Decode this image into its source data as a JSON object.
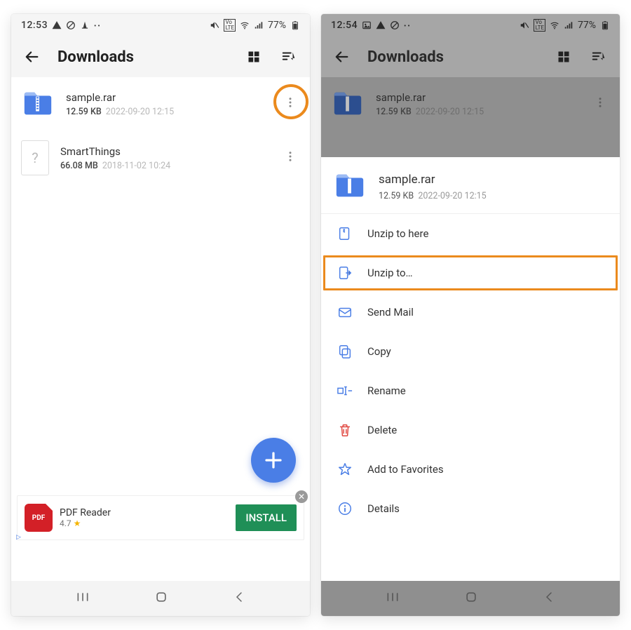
{
  "left": {
    "status": {
      "time": "12:53",
      "battery": "77%"
    },
    "appbar_title": "Downloads",
    "files": [
      {
        "name": "sample.rar",
        "size": "12.59 KB",
        "date": "2022-09-20 12:15"
      },
      {
        "name": "SmartThings",
        "size": "66.08 MB",
        "date": "2018-11-02 10:24"
      }
    ],
    "ad": {
      "title": "PDF Reader",
      "rating": "4.7",
      "cta": "INSTALL",
      "icon_label": "PDF"
    }
  },
  "right": {
    "status": {
      "time": "12:54",
      "battery": "77%"
    },
    "appbar_title": "Downloads",
    "file": {
      "name": "sample.rar",
      "size": "12.59 KB",
      "date": "2022-09-20 12:15"
    },
    "sheet_file": {
      "name": "sample.rar",
      "size": "12.59 KB",
      "date": "2022-09-20 12:15"
    },
    "menu": {
      "unzip_here": "Unzip to here",
      "unzip_to": "Unzip to…",
      "send_mail": "Send Mail",
      "copy": "Copy",
      "rename": "Rename",
      "delete": "Delete",
      "favorites": "Add to Favorites",
      "details": "Details"
    }
  }
}
